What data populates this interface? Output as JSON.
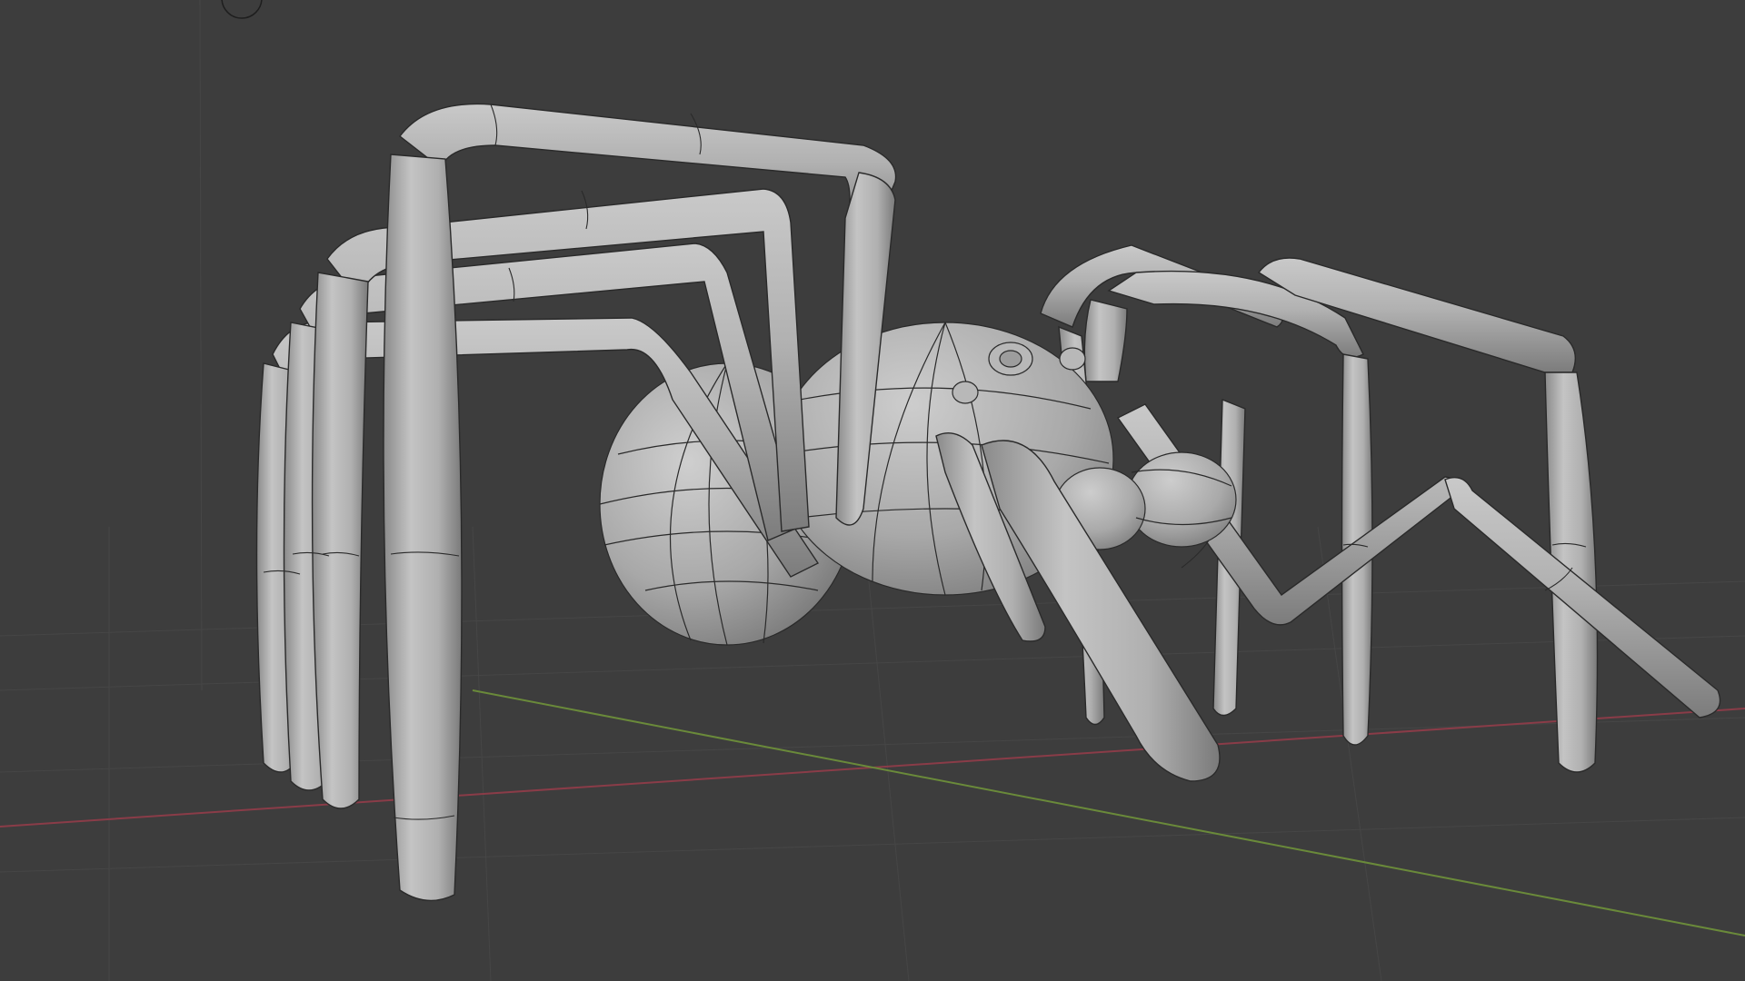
{
  "app": {
    "name": "3D Viewport",
    "scene_object": "spider",
    "shading": "solid",
    "overlay": "wireframe"
  },
  "colors": {
    "background": "#3d3d3d",
    "grid_line": "#474747",
    "x_axis": "#8a3c48",
    "y_axis": "#6a8a3a",
    "mesh_fill": "#a9a9a9",
    "mesh_edge": "#2a2a2a"
  },
  "icons": {
    "view_gizmo": "origin-circle-icon"
  }
}
